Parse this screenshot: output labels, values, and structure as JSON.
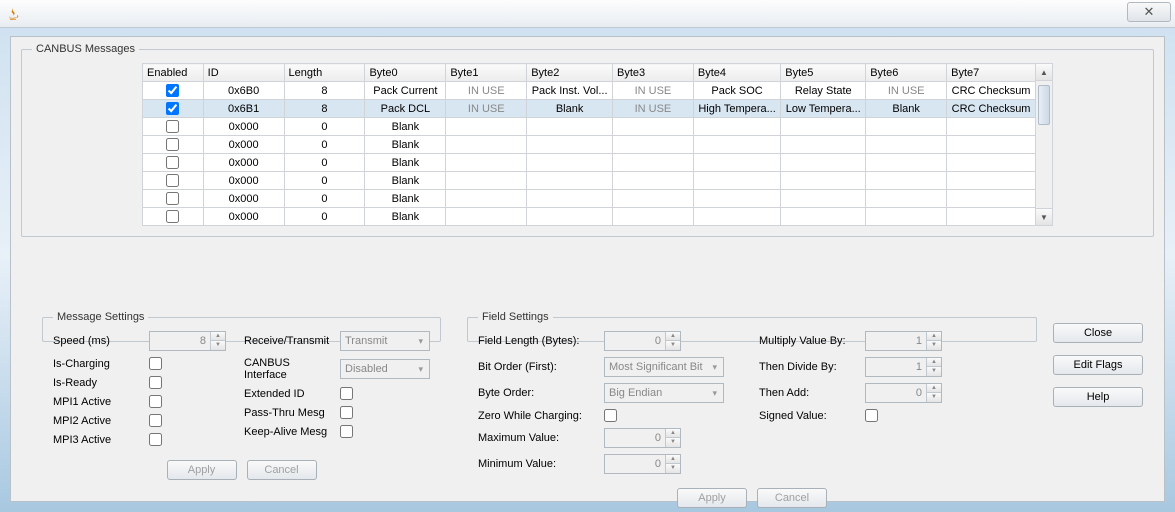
{
  "window": {
    "title": ""
  },
  "group": {
    "canbus": "CANBUS Messages",
    "msg": "Message Settings",
    "fld": "Field Settings"
  },
  "headers": [
    "Enabled",
    "ID",
    "Length",
    "Byte0",
    "Byte1",
    "Byte2",
    "Byte3",
    "Byte4",
    "Byte5",
    "Byte6",
    "Byte7"
  ],
  "rows": [
    {
      "enabled": true,
      "id": "0x6B0",
      "len": "8",
      "b": [
        "Pack Current",
        "IN USE",
        "Pack Inst. Vol...",
        "IN USE",
        "Pack SOC",
        "Relay State",
        "IN USE",
        "CRC Checksum"
      ]
    },
    {
      "enabled": true,
      "id": "0x6B1",
      "len": "8",
      "b": [
        "Pack DCL",
        "IN USE",
        "Blank",
        "IN USE",
        "High Tempera...",
        "Low Tempera...",
        "Blank",
        "CRC Checksum"
      ],
      "selected": true
    },
    {
      "enabled": false,
      "id": "0x000",
      "len": "0",
      "b": [
        "Blank",
        "",
        "",
        "",
        "",
        "",
        "",
        ""
      ]
    },
    {
      "enabled": false,
      "id": "0x000",
      "len": "0",
      "b": [
        "Blank",
        "",
        "",
        "",
        "",
        "",
        "",
        ""
      ]
    },
    {
      "enabled": false,
      "id": "0x000",
      "len": "0",
      "b": [
        "Blank",
        "",
        "",
        "",
        "",
        "",
        "",
        ""
      ]
    },
    {
      "enabled": false,
      "id": "0x000",
      "len": "0",
      "b": [
        "Blank",
        "",
        "",
        "",
        "",
        "",
        "",
        ""
      ]
    },
    {
      "enabled": false,
      "id": "0x000",
      "len": "0",
      "b": [
        "Blank",
        "",
        "",
        "",
        "",
        "",
        "",
        ""
      ]
    },
    {
      "enabled": false,
      "id": "0x000",
      "len": "0",
      "b": [
        "Blank",
        "",
        "",
        "",
        "",
        "",
        "",
        ""
      ]
    }
  ],
  "msg": {
    "speed_lbl": "Speed (ms)",
    "speed": "8",
    "ischarging": "Is-Charging",
    "isready": "Is-Ready",
    "mpi1": "MPI1 Active",
    "mpi2": "MPI2 Active",
    "mpi3": "MPI3 Active",
    "rxTx_lbl": "Receive/Transmit",
    "rxTx": "Transmit",
    "iface_lbl": "CANBUS Interface",
    "iface": "Disabled",
    "extid": "Extended ID",
    "passthru": "Pass-Thru Mesg",
    "keepalive": "Keep-Alive Mesg",
    "apply": "Apply",
    "cancel": "Cancel"
  },
  "fld": {
    "len_lbl": "Field Length (Bytes):",
    "len": "0",
    "bitorder_lbl": "Bit Order (First):",
    "bitorder": "Most Significant Bit",
    "byteorder_lbl": "Byte Order:",
    "byteorder": "Big Endian",
    "zero_lbl": "Zero While Charging:",
    "max_lbl": "Maximum Value:",
    "max": "0",
    "min_lbl": "Minimum Value:",
    "min": "0",
    "mult_lbl": "Multiply Value By:",
    "mult": "1",
    "div_lbl": "Then Divide By:",
    "div": "1",
    "add_lbl": "Then Add:",
    "add": "0",
    "signed_lbl": "Signed Value:",
    "apply": "Apply",
    "cancel": "Cancel"
  },
  "side": {
    "close": "Close",
    "edit": "Edit Flags",
    "help": "Help"
  }
}
